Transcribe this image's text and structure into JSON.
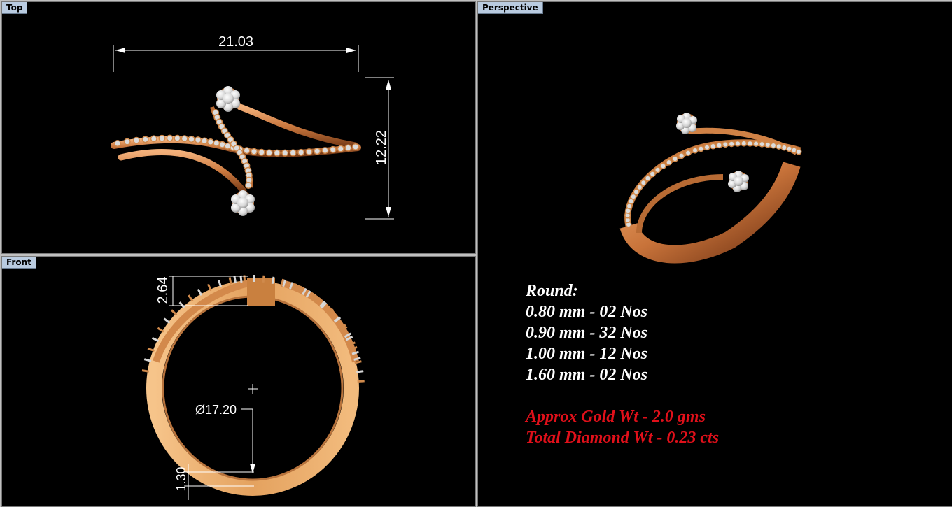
{
  "viewports": {
    "top": {
      "label": "Top",
      "dimensions": {
        "width": "21.03",
        "height": "12.22"
      }
    },
    "front": {
      "label": "Front",
      "dimensions": {
        "top": "2.64",
        "diameter": "Ø17.20",
        "bottom": "1.30"
      }
    },
    "perspective": {
      "label": "Perspective"
    }
  },
  "specs": {
    "heading": "Round:",
    "lines": [
      "0.80 mm - 02 Nos",
      "0.90 mm - 32 Nos",
      "1.00 mm - 12 Nos",
      "1.60 mm - 02 Nos"
    ],
    "gold_weight": "Approx Gold Wt - 2.0 gms",
    "diamond_weight": "Total Diamond Wt - 0.23 cts"
  },
  "colors": {
    "viewport_bg": "#000000",
    "tab_bg": "#b9cbe0",
    "gold": "#d8894e",
    "diamond": "#e8e8e8",
    "spec_red": "#e0101a"
  }
}
